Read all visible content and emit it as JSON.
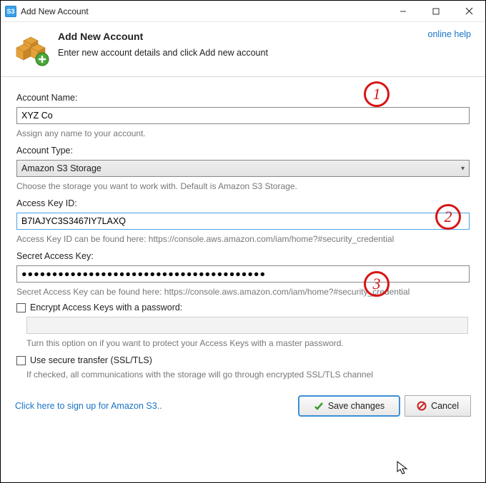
{
  "titlebar": {
    "app_badge": "S3",
    "title": "Add New Account"
  },
  "header": {
    "title": "Add New Account",
    "subtitle": "Enter new account details and click Add new account",
    "help_link": "online help"
  },
  "callouts": {
    "one": "1",
    "two": "2",
    "three": "3"
  },
  "form": {
    "account_name": {
      "label": "Account Name:",
      "value": "XYZ Co",
      "hint": "Assign any name to your account."
    },
    "account_type": {
      "label": "Account Type:",
      "value": "Amazon S3 Storage",
      "hint": "Choose the storage you want to work with. Default is Amazon S3 Storage."
    },
    "access_key": {
      "label": "Access Key ID:",
      "value": "B7IAJYC3S3467IY7LAXQ",
      "hint": "Access Key ID can be found here: https://console.aws.amazon.com/iam/home?#security_credential"
    },
    "secret_key": {
      "label": "Secret Access Key:",
      "value": "●●●●●●●●●●●●●●●●●●●●●●●●●●●●●●●●●●●●●●●●",
      "hint": "Secret Access Key can be found here: https://console.aws.amazon.com/iam/home?#security_credential"
    },
    "encrypt": {
      "label": "Encrypt Access Keys with a password:",
      "hint": "Turn this option on if you want to protect your Access Keys with a master password."
    },
    "ssl": {
      "label": "Use secure transfer (SSL/TLS)",
      "hint": "If checked, all communications with the storage will go through encrypted SSL/TLS channel"
    }
  },
  "footer": {
    "signup_link": "Click here to sign up for Amazon S3..",
    "save_label": "Save changes",
    "cancel_label": "Cancel"
  }
}
